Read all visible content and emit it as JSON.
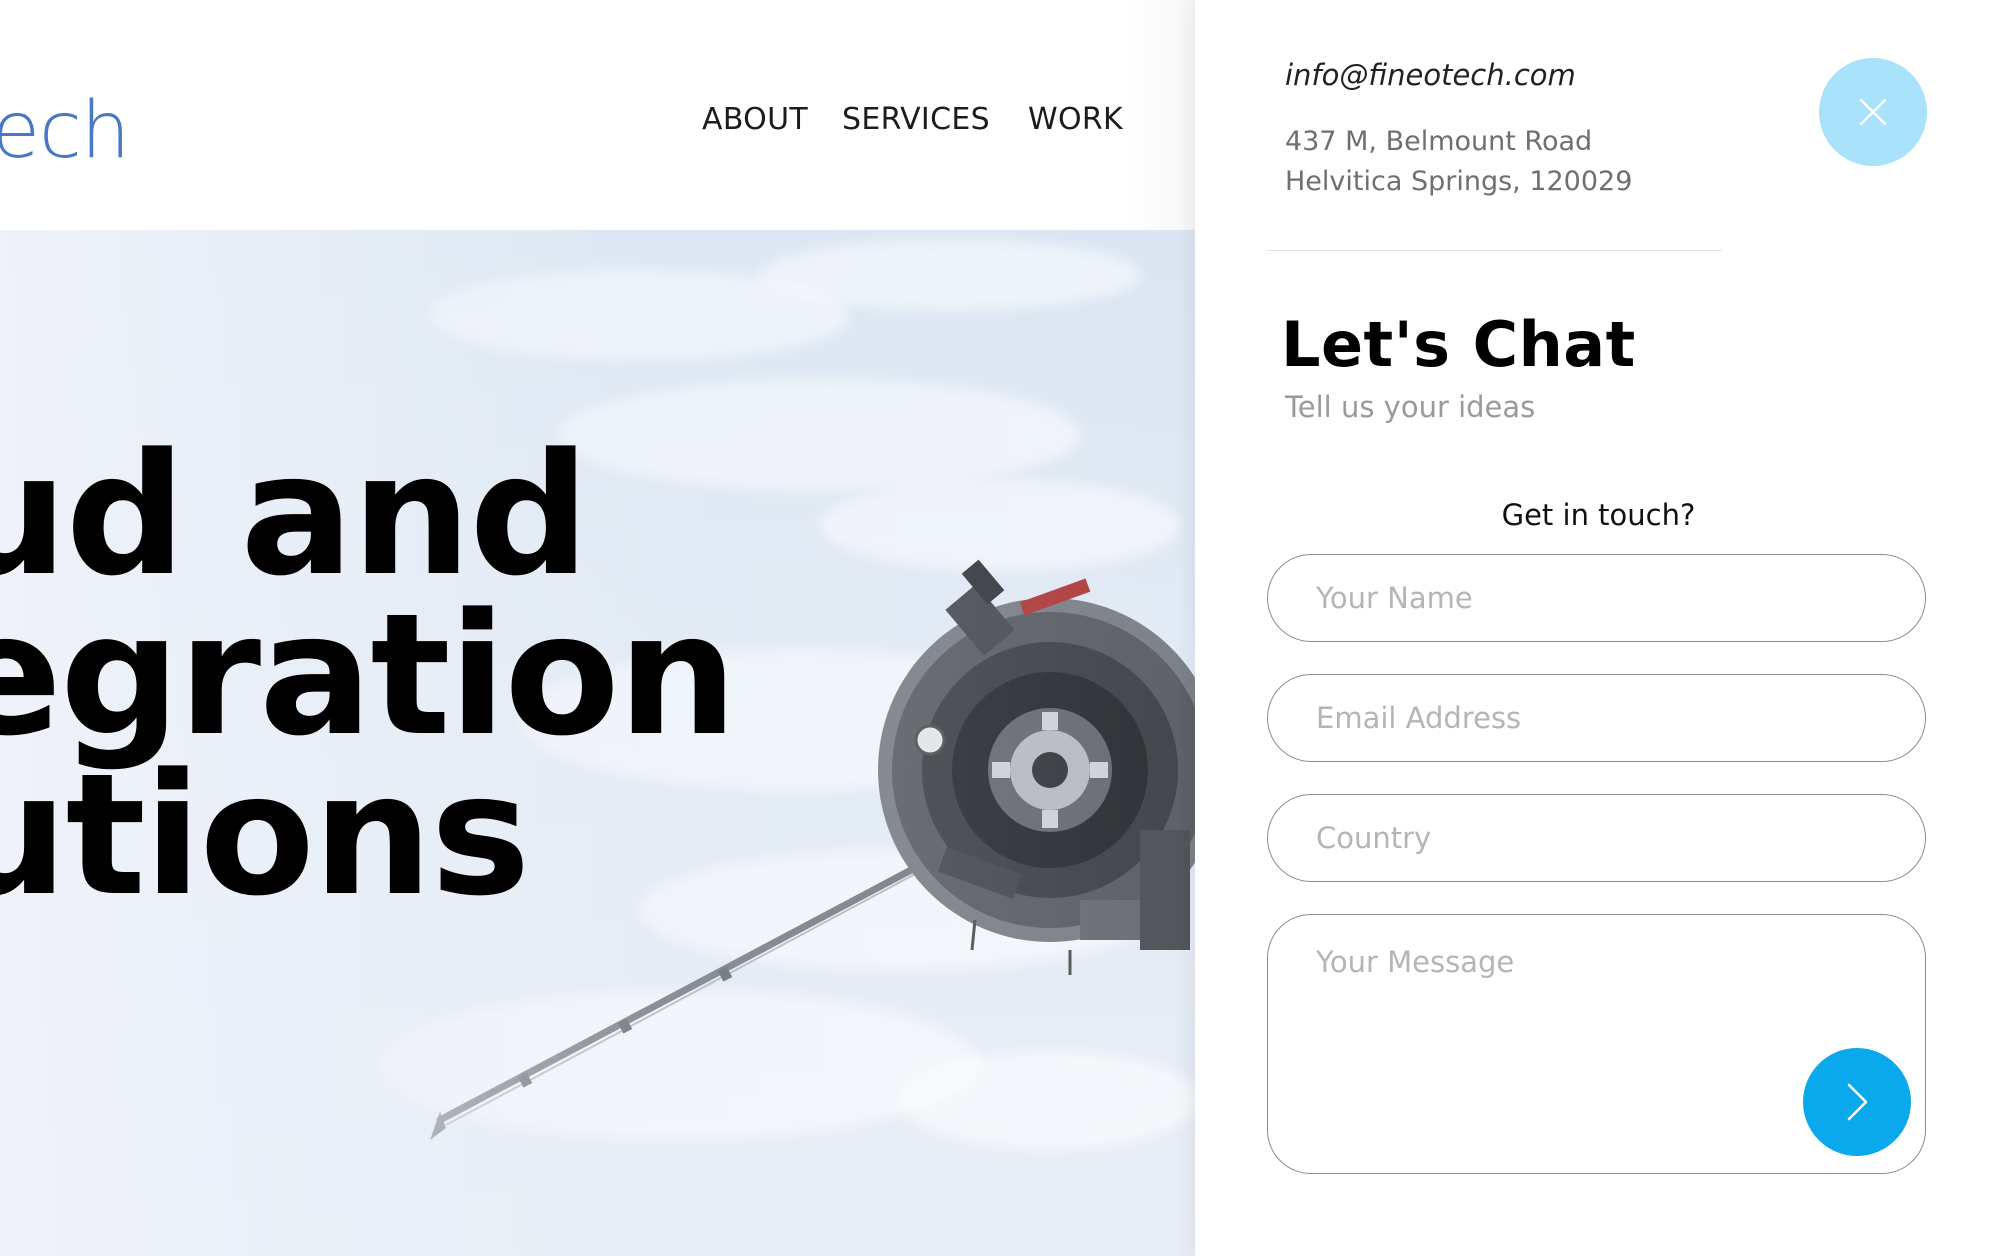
{
  "header": {
    "logo_text": "ech",
    "nav": [
      {
        "label": "ABOUT"
      },
      {
        "label": "SERVICES"
      },
      {
        "label": "WORK"
      }
    ]
  },
  "hero": {
    "title_lines": [
      "ud and",
      "egration",
      "utions"
    ]
  },
  "drawer": {
    "email": "info@fineotech.com",
    "address_line1": "437 M, Belmount Road",
    "address_line2": "Helvitica Springs, 120029",
    "close_icon": "close-icon",
    "title": "Let's Chat",
    "subtitle": "Tell us your ideas",
    "prompt": "Get in touch?",
    "form": {
      "name_placeholder": "Your Name",
      "email_placeholder": "Email Address",
      "country_placeholder": "Country",
      "message_placeholder": "Your Message",
      "send_icon": "chevron-right-icon"
    }
  },
  "colors": {
    "logo": "#4a78c4",
    "close_button": "#a9e2fb",
    "send_button": "#0aa9ec"
  }
}
